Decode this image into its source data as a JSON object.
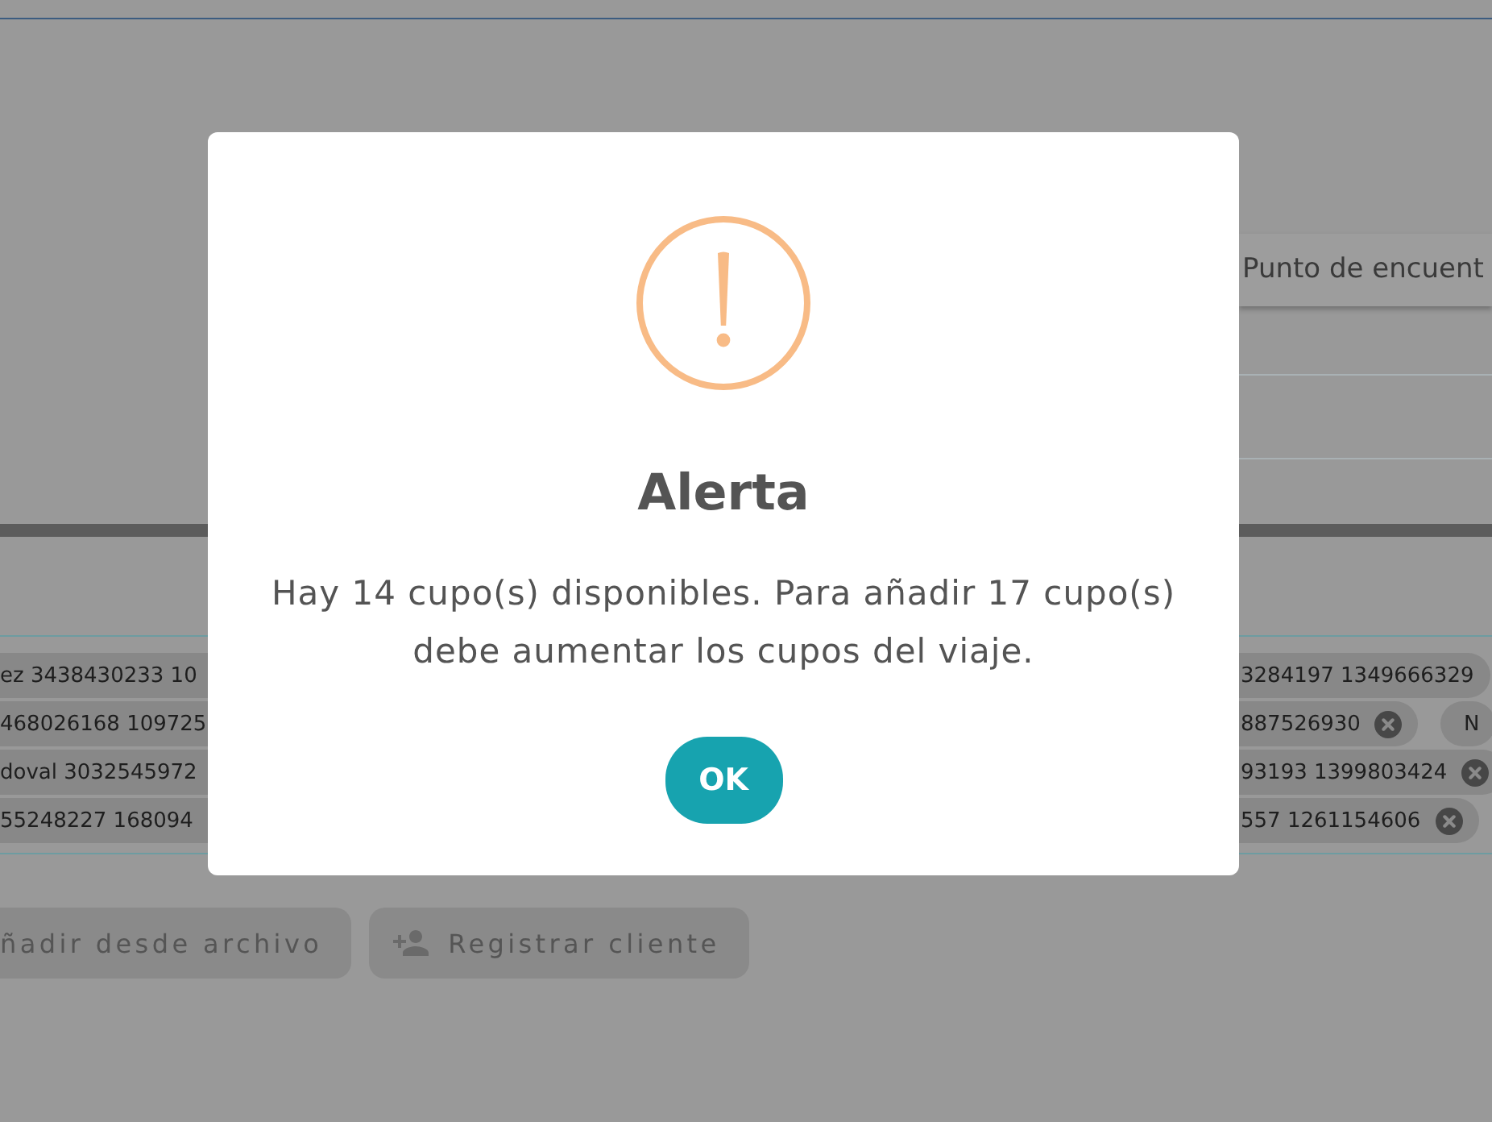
{
  "page": {
    "table": {
      "header": "Punto de encuent"
    },
    "client_chips": [
      {
        "left": {
          "label": "ez 3438430233 10"
        },
        "right": [
          {
            "label": "3284197 1349666329",
            "removable": false
          }
        ]
      },
      {
        "left": {
          "label": "468026168 109725"
        },
        "right": [
          {
            "label": "887526930",
            "removable": true
          },
          {
            "label": "N",
            "removable": false
          }
        ]
      },
      {
        "left": {
          "label": "doval 3032545972"
        },
        "right": [
          {
            "label": "93193 1399803424",
            "removable": true
          }
        ]
      },
      {
        "left": {
          "label": "55248227 168094"
        },
        "right": [
          {
            "label": "557 1261154606",
            "removable": true
          }
        ]
      }
    ],
    "buttons": [
      {
        "label": "ñadir desde archivo",
        "kind": "file",
        "disabled": true
      },
      {
        "label": "Registrar cliente",
        "kind": "register",
        "disabled": true
      }
    ]
  },
  "dialog": {
    "title": "Alerta",
    "message": "Hay 14 cupo(s) disponibles. Para añadir 17 cupo(s) debe aumentar los cupos del viaje.",
    "button": "OK"
  }
}
